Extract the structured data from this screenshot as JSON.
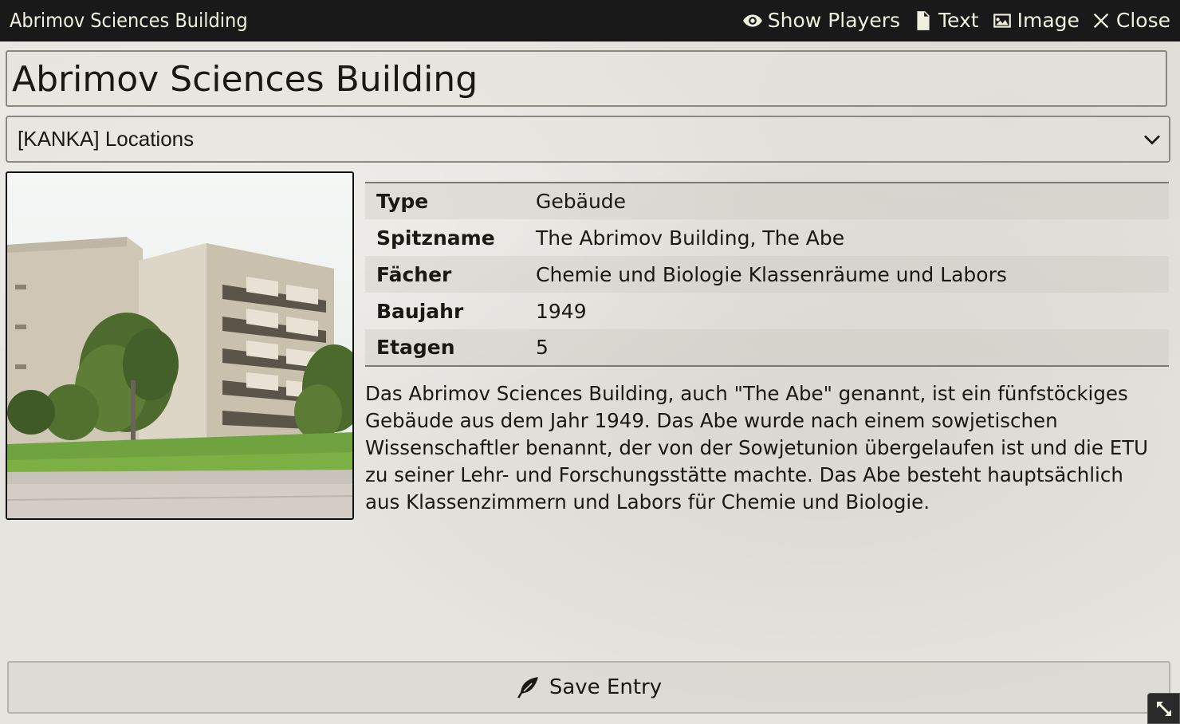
{
  "window": {
    "title": "Abrimov Sciences Building",
    "controls": {
      "show_players": "Show Players",
      "text": "Text",
      "image": "Image",
      "close": "Close"
    }
  },
  "entry": {
    "name": "Abrimov Sciences Building",
    "folder": "[KANKA] Locations"
  },
  "stats": [
    {
      "label": "Type",
      "value": "Gebäude"
    },
    {
      "label": "Spitzname",
      "value": "The Abrimov Building, The Abe"
    },
    {
      "label": "Fächer",
      "value": "Chemie und Biologie Klassenräume und Labors"
    },
    {
      "label": "Baujahr",
      "value": "1949"
    },
    {
      "label": "Etagen",
      "value": "5"
    }
  ],
  "description": "Das Abrimov Sciences Building, auch \"The Abe\" genannt, ist ein fünfstöckiges Gebäude aus dem Jahr 1949. Das Abe wurde nach einem sowjetischen Wissenschaftler benannt, der von der Sowjetunion übergelaufen ist und die ETU zu seiner Lehr- und Forschungsstätte machte. Das Abe besteht hauptsächlich aus Klassenzimmern und Labors für Chemie und Biologie.",
  "save_label": "Save Entry",
  "icons": {
    "show_players": "eye-icon",
    "text": "file-text-icon",
    "image": "image-icon",
    "close": "close-icon",
    "select": "chevron-down-icon",
    "save": "feather-icon",
    "resize": "expand-icon"
  },
  "colors": {
    "header_bg": "#191919",
    "header_text": "#f0f0e0",
    "parchment": "#e6e4df",
    "text": "#191813"
  }
}
